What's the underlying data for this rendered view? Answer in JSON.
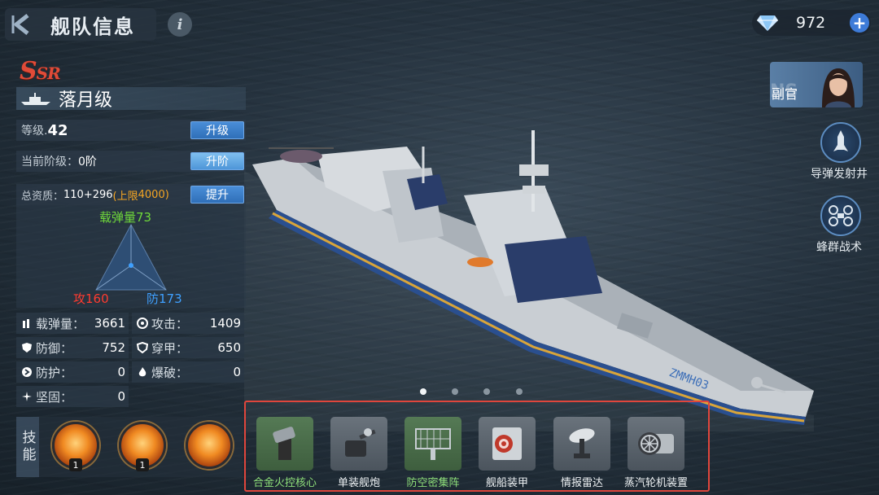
{
  "header": {
    "title": "舰队信息",
    "info_icon": "i",
    "currency_amount": "972",
    "currency_plus": "+"
  },
  "ship": {
    "rarity_main": "S",
    "rarity_sub": "SR",
    "name": "落月级",
    "level_label": "等级.",
    "level_value": "42",
    "upgrade_button": "升级",
    "stage_label": "当前阶级：",
    "stage_value": "0阶",
    "stage_button": "升阶",
    "quality_label": "总资质：",
    "quality_value": "110+296",
    "quality_limit_prefix": "(上限",
    "quality_limit_value": "4000",
    "quality_limit_suffix": ")",
    "quality_button": "提升",
    "hull_number": "ZMMH03"
  },
  "radar": {
    "top_label": "载弹量",
    "top_value": "73",
    "left_label": "攻",
    "left_value": "160",
    "right_label": "防",
    "right_value": "173"
  },
  "stats": [
    {
      "label": "载弹量：",
      "value": "3661",
      "icon": "ammo-icon"
    },
    {
      "label": "攻击：",
      "value": "1409",
      "icon": "attack-icon"
    },
    {
      "label": "防御：",
      "value": "752",
      "icon": "defense-icon"
    },
    {
      "label": "穿甲：",
      "value": "650",
      "icon": "pierce-icon"
    },
    {
      "label": "防护：",
      "value": "0",
      "icon": "protect-icon"
    },
    {
      "label": "爆破：",
      "value": "0",
      "icon": "blast-icon"
    },
    {
      "label": "坚固：",
      "value": "0",
      "icon": "sturdy-icon"
    }
  ],
  "skills": {
    "label": "技能",
    "items": [
      {
        "badge": "1"
      },
      {
        "badge": "1"
      },
      {
        "badge": ""
      }
    ]
  },
  "equipment": [
    {
      "label": "合金火控核心",
      "highlight": true
    },
    {
      "label": "单装舰炮",
      "highlight": false
    },
    {
      "label": "防空密集阵",
      "highlight": true
    },
    {
      "label": "舰船装甲",
      "highlight": false
    },
    {
      "label": "情报雷达",
      "highlight": false
    },
    {
      "label": "蒸汽轮机装置",
      "highlight": false
    }
  ],
  "pager": {
    "total": 4,
    "active": 1
  },
  "right_panel": {
    "officer_label": "副官",
    "officer_watermark": "NS",
    "missile_label": "导弹发射井",
    "swarm_label": "蜂群战术"
  },
  "colors": {
    "rarity": "#e04b38",
    "attack": "#ff3b30",
    "defense": "#3fa0ff",
    "ammo": "#6fd83a",
    "limit": "#f5a623",
    "highlight_frame": "#e0463c"
  }
}
